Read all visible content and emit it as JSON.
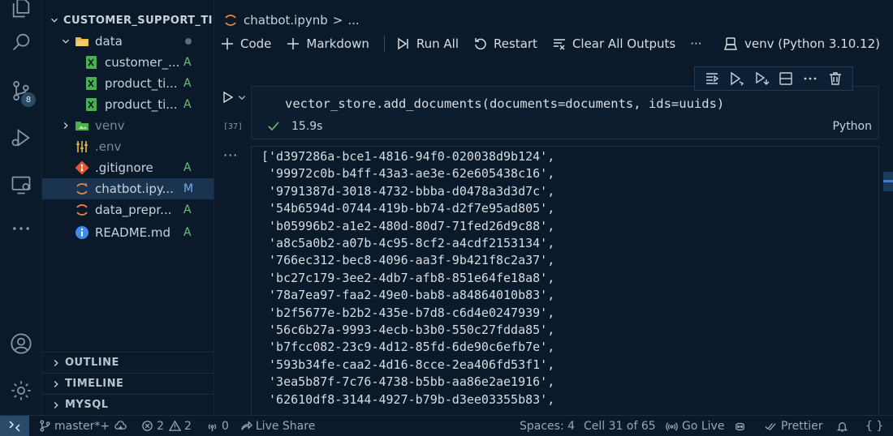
{
  "explorer": {
    "root": "CUSTOMER_SUPPORT_TI...",
    "items": [
      {
        "label": "data",
        "type": "folder-open",
        "status": ""
      },
      {
        "label": "customer_...",
        "type": "sheet",
        "status": "A"
      },
      {
        "label": "product_ti...",
        "type": "sheet",
        "status": "A"
      },
      {
        "label": "product_ti...",
        "type": "sheet",
        "status": "A"
      },
      {
        "label": "venv",
        "type": "folder",
        "status": ""
      },
      {
        "label": ".env",
        "type": "env",
        "status": ""
      },
      {
        "label": ".gitignore",
        "type": "git",
        "status": "A"
      },
      {
        "label": "chatbot.ipy...",
        "type": "notebook",
        "status": "M"
      },
      {
        "label": "data_prepr...",
        "type": "notebook",
        "status": "A"
      },
      {
        "label": "README.md",
        "type": "info",
        "status": "A"
      }
    ],
    "sections": [
      "OUTLINE",
      "TIMELINE",
      "MYSQL"
    ]
  },
  "activity": {
    "source_control_badge": "8"
  },
  "breadcrumb": {
    "file": "chatbot.ipynb",
    "separator": ">",
    "more": "..."
  },
  "toolbar": {
    "code": "Code",
    "markdown": "Markdown",
    "run_all": "Run All",
    "restart": "Restart",
    "clear_outputs": "Clear All Outputs",
    "more": "···",
    "kernel": "venv (Python 3.10.12)"
  },
  "cell": {
    "code": "vector_store.add_documents(documents=documents, ids=uuids)",
    "exec_count": "[37]",
    "duration": "15.9s",
    "language": "Python"
  },
  "output": {
    "more": "···",
    "lines": [
      "['d397286a-bce1-4816-94f0-020038d9b124',",
      " '99972c0b-b4ff-43a3-ae3e-62e605438c16',",
      " '9791387d-3018-4732-bbba-d0478a3d3d7c',",
      " '54b6594d-0744-419b-bb74-d2f7e95ad805',",
      " 'b05996b2-a1e2-480d-80d7-71fed26d9c88',",
      " 'a8c5a0b2-a07b-4c95-8cf2-a4cdf2153134',",
      " '766ec312-bec8-4096-aa3f-9b421f8c2a37',",
      " 'bc27c179-3ee2-4db7-afb8-851e64fe18a8',",
      " '78a7ea97-faa2-49e0-bab8-a84864010b83',",
      " 'b2f5677e-b2b2-435e-b7d8-c6d4e0247939',",
      " '56c6b27a-9993-4ecb-b3b0-550c27fdda85',",
      " 'b7fcc082-23c9-4d12-85fd-6de90c6efb7e',",
      " '593b34fe-caa2-4d16-8cce-2ea406fd53f1',",
      " '3ea5b87f-7c76-4738-b5bb-aa86e2ae1916',",
      " '62610df8-3144-4927-b79b-d3ee03355b83',"
    ]
  },
  "statusbar": {
    "branch": "master*+",
    "errors": "2",
    "warnings": "2",
    "ports": "0",
    "live_share": "Live Share",
    "spaces": "Spaces: 4",
    "cell_position": "Cell 31 of 65",
    "go_live": "Go Live",
    "prettier": "Prettier",
    "braces": "{ }"
  },
  "colors": {
    "background": "#0b1a2b",
    "selection": "#1a3450",
    "added": "#6fbf73",
    "modified": "#7aa8e8",
    "notebook_orange": "#f0883e",
    "success_check": "#6fbf73"
  }
}
